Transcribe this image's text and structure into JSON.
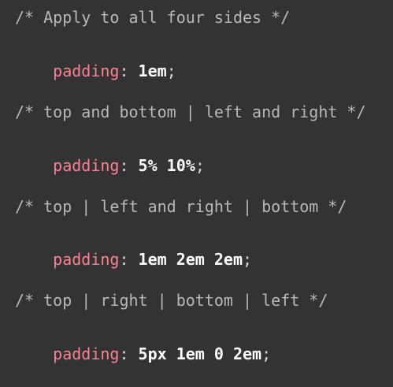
{
  "code_lines": [
    {
      "type": "comment",
      "text": "/* Apply to all four sides */"
    },
    {
      "type": "declaration",
      "property": "padding",
      "colon": ":",
      "value": " 1em",
      "semicolon": ";"
    },
    {
      "type": "comment",
      "text": "/* top and bottom | left and right */"
    },
    {
      "type": "declaration",
      "property": "padding",
      "colon": ":",
      "value": " 5% 10%",
      "semicolon": ";"
    },
    {
      "type": "comment",
      "text": "/* top | left and right | bottom */"
    },
    {
      "type": "declaration",
      "property": "padding",
      "colon": ":",
      "value": " 1em 2em 2em",
      "semicolon": ";"
    },
    {
      "type": "comment",
      "text": "/* top | right | bottom | left */"
    },
    {
      "type": "declaration",
      "property": "padding",
      "colon": ":",
      "value": " 5px 1em 0 2em",
      "semicolon": ";"
    }
  ],
  "colors": {
    "background": "#333333",
    "comment": "#b8b8b8",
    "property": "#ff7f93",
    "value": "#ffffff"
  }
}
